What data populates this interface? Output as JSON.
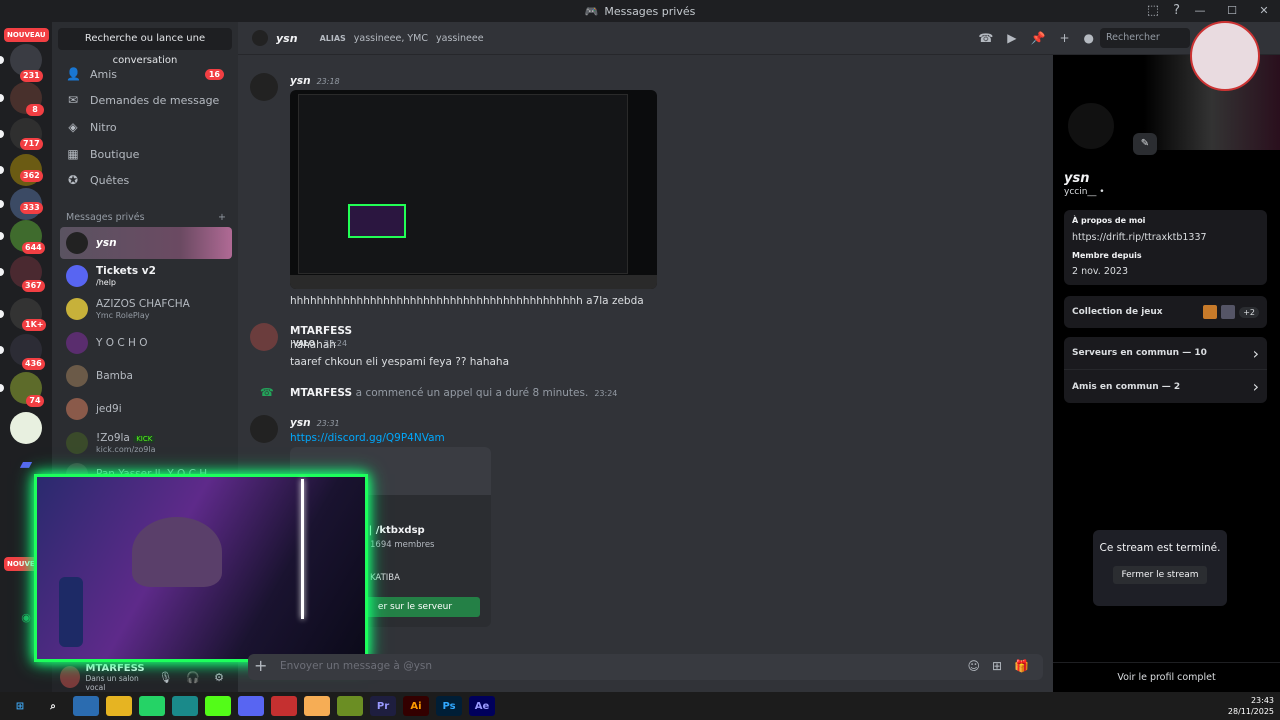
{
  "window": {
    "title": "Messages privés",
    "controls": [
      "—",
      "☐",
      "✕"
    ]
  },
  "rail": {
    "new_badge": "NOUVEAU",
    "servers": [
      {
        "badge": "231"
      },
      {
        "badge": "8"
      },
      {
        "badge": "717"
      },
      {
        "badge": "362"
      },
      {
        "badge": "333"
      },
      {
        "badge": "644"
      },
      {
        "badge": "367"
      },
      {
        "badge": "1K+"
      },
      {
        "badge": "436"
      },
      {
        "badge": "74"
      }
    ],
    "new_badge_bottom": "NOUVEAU"
  },
  "sidebar": {
    "search_label": "Recherche ou lance une conversation",
    "nav": [
      {
        "label": "Amis",
        "count": "16"
      },
      {
        "label": "Demandes de message"
      },
      {
        "label": "Nitro"
      },
      {
        "label": "Boutique"
      },
      {
        "label": "Quêtes"
      }
    ],
    "dm_header": "Messages privés",
    "dm_add": "+",
    "dms": [
      {
        "name": "ysn",
        "sub": ""
      },
      {
        "name": "Tickets v2",
        "sub": "/help"
      },
      {
        "name": "AZIZOS CHAFCHA",
        "sub": "Ymc RolePlay"
      },
      {
        "name": "Y O C H O",
        "sub": ""
      },
      {
        "name": "Bamba",
        "sub": ""
      },
      {
        "name": "jed9i",
        "sub": ""
      },
      {
        "name": "!Zo9la",
        "sub": "kick.com/zo9la",
        "tag": "KICK"
      },
      {
        "name": "Pan Yasser ll. Y O C H",
        "sub": ""
      }
    ],
    "user": {
      "name": "MTARFESS",
      "status": "Dans un salon vocal"
    }
  },
  "chat": {
    "header_name": "ysn",
    "alias_label": "ALIAS",
    "aliases": "yassineee, YMC",
    "alias_extra": "yassineee",
    "search_placeholder": "Rechercher",
    "messages": [
      {
        "author": "ysn",
        "time": "23:18",
        "text": "hhhhhhhhhhhhhhhhhhhhhhhhhhhhhhhhhhhhhhhhhhhh a7la zebda"
      },
      {
        "author": "MTARFESS",
        "tag": "VALO",
        "time": "23:24",
        "lines": [
          "hahahah",
          "taaref chkoun eli yespami feya ?? hahaha"
        ]
      },
      {
        "author": "MTARFESS",
        "call_text": "a commencé un appel qui a duré 8 minutes.",
        "time": "23:24"
      },
      {
        "author": "ysn",
        "time": "23:31",
        "link": "https://discord.gg/Q9P4NVam"
      }
    ],
    "invite": {
      "name": "air | /ktbxdsp",
      "members": "1694 membres",
      "tag": "KATIBA",
      "button": "er sur le serveur"
    },
    "composer_placeholder": "Envoyer un message à @ysn"
  },
  "profile": {
    "name": "ysn",
    "handle": "yccin__ •",
    "about_label": "À propos de moi",
    "about_link": "https://drift.rip/ttraxktb1337",
    "member_since_label": "Membre depuis",
    "member_since": "2 nov. 2023",
    "games_label": "Collection de jeux",
    "games_more": "+2",
    "servers_common": "Serveurs en commun — 10",
    "friends_common": "Amis en commun — 2",
    "stream_ended": "Ce stream est terminé.",
    "close_stream": "Fermer le stream",
    "full_profile": "Voir le profil complet"
  },
  "taskbar": {
    "apps": [
      "Pr",
      "Ai",
      "Ps",
      "Ae"
    ],
    "time": "23:43",
    "date": "28/11/2025"
  },
  "colors": {
    "accent": "#5865f2",
    "green": "#248046",
    "link": "#00a8fc",
    "red": "#f23f43"
  }
}
